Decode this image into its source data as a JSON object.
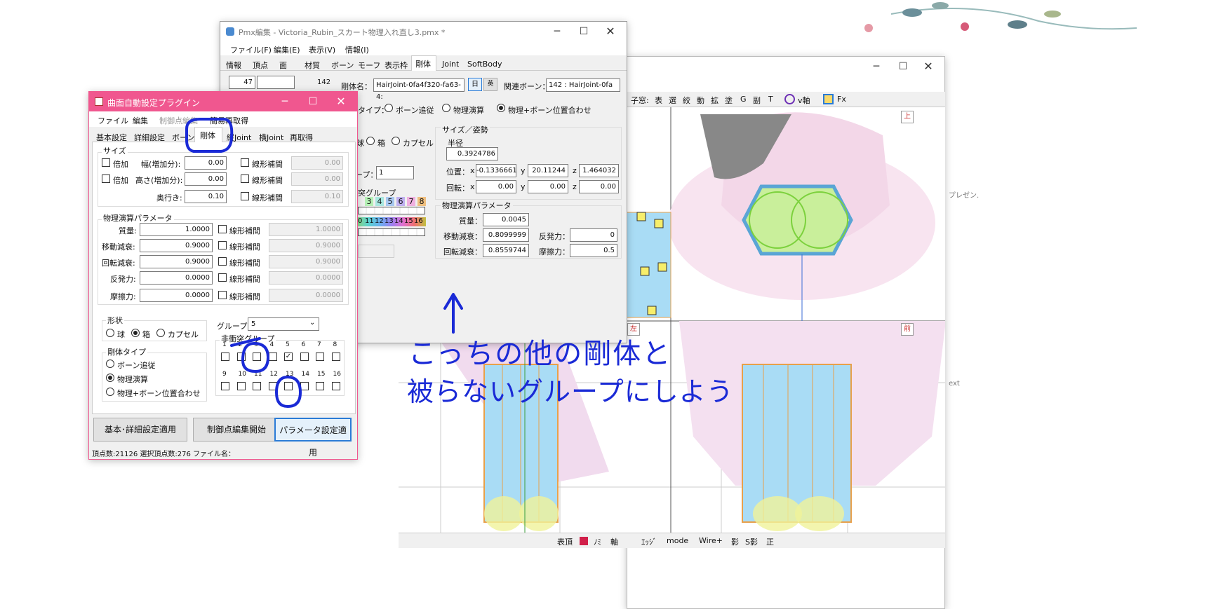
{
  "pmx": {
    "title": "Pmx編集 - Victoria_Rubin_スカート物理入れ直し3.pmx *",
    "menu": [
      "ファイル(F)",
      "編集(E)",
      "表示(V)",
      "情報(I)"
    ],
    "tabs": [
      "情報",
      "頂点",
      "面",
      "材質",
      "ボーン",
      "モーフ",
      "表示枠",
      "剛体",
      "Joint",
      "SoftBody"
    ],
    "index": "47",
    "count": "142",
    "body_name_label": "剛体名：",
    "body_name": "HairJoint-0fa4f320-fa63-4:",
    "jp_btn": "日",
    "en_btn": "英",
    "bone_label": "関連ボーン：",
    "bone_value": "142 : HairJoint-0fa",
    "type_label": "タイプ：",
    "type_options": [
      "ボーン追従",
      "物理演算",
      "物理+ボーン位置合わせ"
    ],
    "shape_options": [
      "球",
      "箱",
      "カプセル"
    ],
    "group_label": "ープ：",
    "group_value": "1",
    "noncollide_label": "突グループ",
    "group_colors_row": [
      "3",
      "4",
      "5",
      "6",
      "7",
      "8"
    ],
    "group_colors_row2": [
      "0",
      "11",
      "12",
      "13",
      "14",
      "15",
      "16"
    ],
    "size_section": "サイズ／姿勢",
    "radius_label": "半径",
    "radius": "0.3924786",
    "pos_label": "位置：",
    "pos_x": "-0.1336661",
    "pos_y": "20.11244",
    "pos_z": "1.464032",
    "rot_label": "回転：",
    "rot_x": "0.00",
    "rot_y": "0.00",
    "rot_z": "0.00",
    "x": "x",
    "y": "y",
    "z": "z",
    "phys_section": "物理演算パラメータ",
    "mass_label": "質量：",
    "mass": "0.0045",
    "move_damp_label": "移動減衰：",
    "move_damp": "0.8099999",
    "repulse_label": "反発力：",
    "repulse": "0",
    "rot_damp_label": "回転減衰：",
    "rot_damp": "0.8559744",
    "friction_label": "摩擦力：",
    "friction": "0.5"
  },
  "viewer": {
    "toolbar": [
      "子窓:",
      "表",
      "選",
      "絞",
      "動",
      "拡",
      "塗",
      "G",
      "副",
      "T",
      "v軸",
      "Fx"
    ],
    "view_labels": [
      "上",
      "左",
      "前"
    ],
    "bottom": [
      "表頂",
      "ﾉﾐ",
      "軸",
      "ｴｯｼﾞ",
      "mode",
      "Wire+",
      "影",
      "S影",
      "正"
    ],
    "side_text": [
      "プレゼン.",
      "ext"
    ]
  },
  "plugin": {
    "title": "曲面自動設定プラグイン",
    "menu": [
      "ファイル",
      "編集",
      "制御点編集",
      "簡易再取得"
    ],
    "tabs": [
      "基本設定",
      "詳細設定",
      "ボーン",
      "剛体",
      "縦Joint",
      "横Joint",
      "再取得"
    ],
    "size_section": "サイズ",
    "double": "倍加",
    "width_label": "幅(増加分):",
    "width": "0.00",
    "width2": "0.00",
    "height_label": "高さ(増加分):",
    "height": "0.00",
    "height2": "0.00",
    "depth_label": "奥行き:",
    "depth": "0.10",
    "depth2": "0.10",
    "linear": "線形補間",
    "phys_section": "物理演算パラメータ",
    "mass_label": "質量:",
    "mass": "1.0000",
    "mass2": "1.0000",
    "move_label": "移動減衰:",
    "move": "0.9000",
    "move2": "0.9000",
    "rot_label": "回転減衰:",
    "rot": "0.9000",
    "rot2": "0.9000",
    "rep_label": "反発力:",
    "rep": "0.0000",
    "rep2": "0.0000",
    "fric_label": "摩擦力:",
    "fric": "0.0000",
    "fric2": "0.0000",
    "shape_section": "形状",
    "shapes": [
      "球",
      "箱",
      "カプセル"
    ],
    "type_section": "剛体タイプ",
    "types": [
      "ボーン追従",
      "物理演算",
      "物理+ボーン位置合わせ"
    ],
    "group_label": "グループ",
    "group_value": "5",
    "noncollide_section": "非衝突グループ",
    "nums1": [
      "1",
      "2",
      "3",
      "4",
      "5",
      "6",
      "7",
      "8"
    ],
    "nums2": [
      "9",
      "10",
      "11",
      "12",
      "13",
      "14",
      "15",
      "16"
    ],
    "btn_apply_basic": "基本･詳細設定適用",
    "btn_edit_ctrl": "制御点編集開始",
    "btn_apply_param": "パラメータ設定適用",
    "status": "頂点数:21126  選択頂点数:276  ファイル名："
  },
  "annotation": {
    "line1": "こっちの他の剛体と",
    "line2": "被らないグループにしよう"
  },
  "colors": {
    "plugin_title": "#f0578f",
    "ink": "#1a2ad6",
    "rigid_blue": "#a9dcf5",
    "rigid_edge": "#e8a04a"
  }
}
